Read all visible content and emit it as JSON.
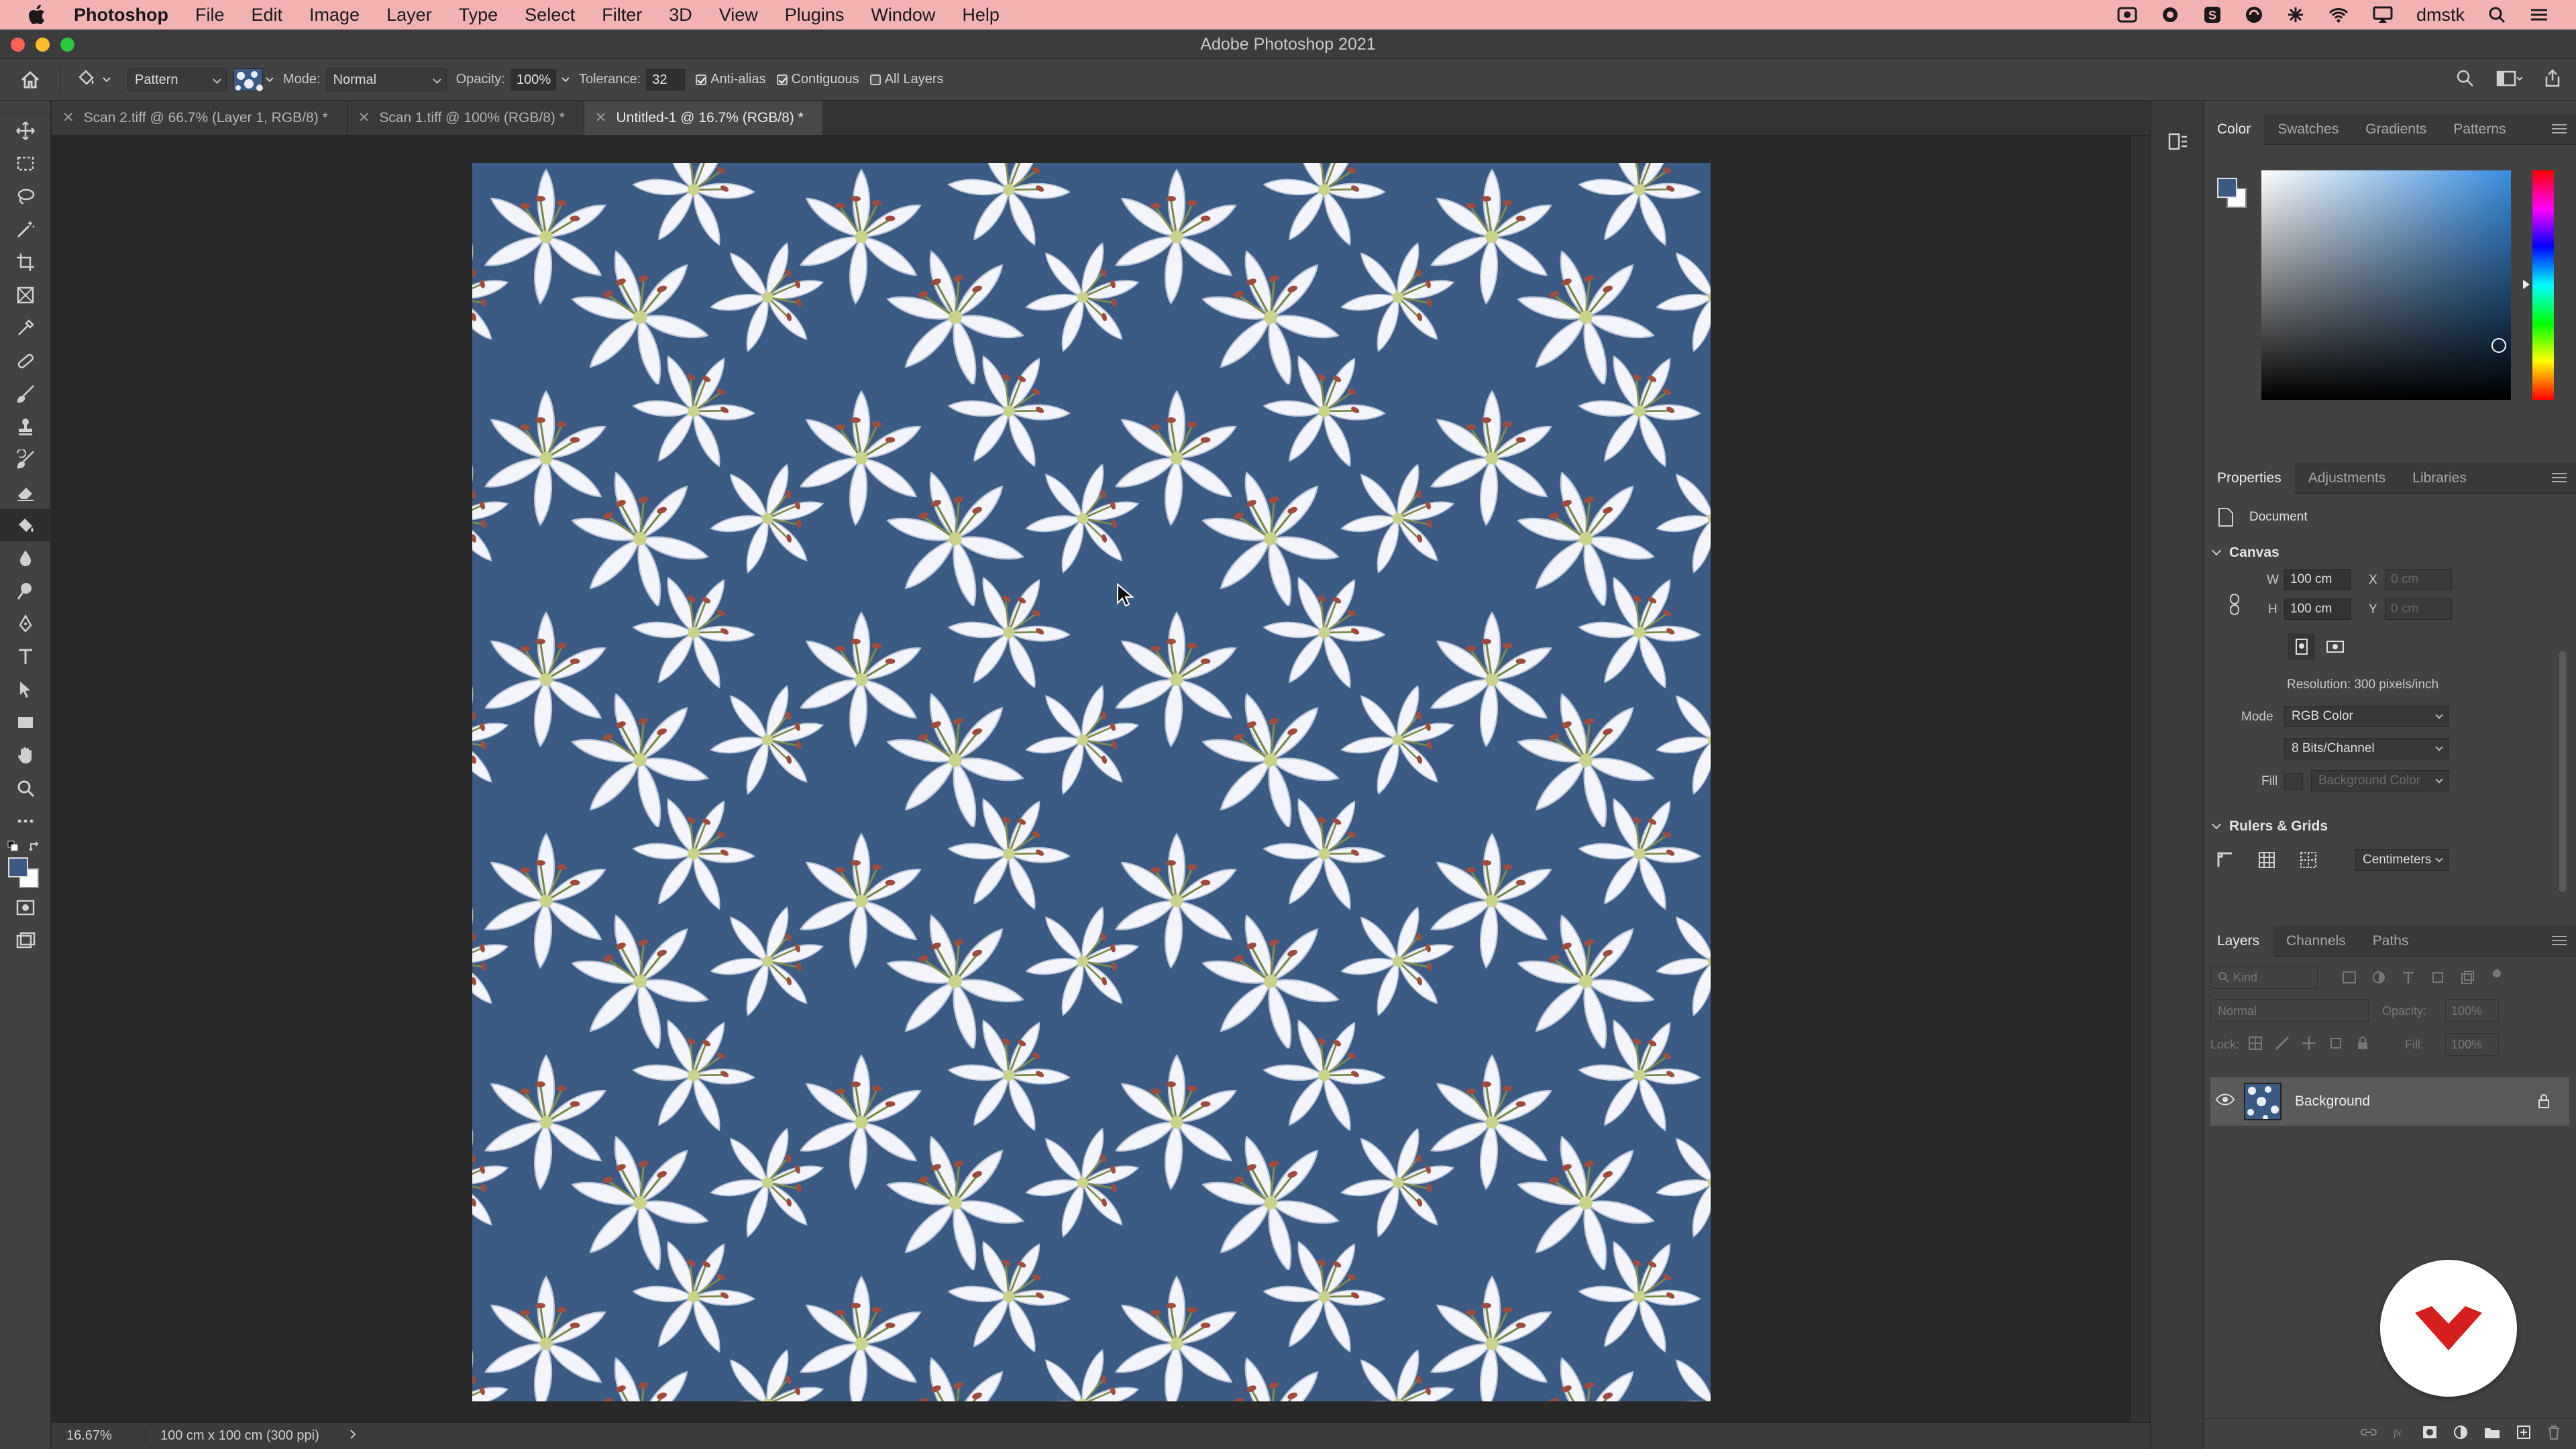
{
  "os_menubar": {
    "app_name": "Photoshop",
    "menus": [
      "File",
      "Edit",
      "Image",
      "Layer",
      "Type",
      "Select",
      "Filter",
      "3D",
      "View",
      "Plugins",
      "Window",
      "Help"
    ],
    "user": "dmstk",
    "status_icons": [
      "creative-cloud-icon",
      "sync-icon",
      "adobe-icon",
      "app-icon",
      "extensions-icon",
      "wifi-icon",
      "airplay-icon",
      "search-icon",
      "control-center-icon"
    ]
  },
  "window": {
    "title": "Adobe Photoshop 2021"
  },
  "options_bar": {
    "fill_source": "Pattern",
    "mode_label": "Mode:",
    "mode_value": "Normal",
    "opacity_label": "Opacity:",
    "opacity_value": "100%",
    "tolerance_label": "Tolerance:",
    "tolerance_value": "32",
    "anti_alias_label": "Anti-alias",
    "anti_alias_checked": true,
    "contiguous_label": "Contiguous",
    "contiguous_checked": true,
    "all_layers_label": "All Layers",
    "all_layers_checked": false
  },
  "tools": [
    "move-tool",
    "marquee-tool",
    "lasso-tool",
    "magic-wand-tool",
    "crop-tool",
    "frame-tool",
    "eyedropper-tool",
    "healing-brush-tool",
    "brush-tool",
    "clone-stamp-tool",
    "history-brush-tool",
    "eraser-tool",
    "paint-bucket-tool",
    "blur-tool",
    "dodge-tool",
    "pen-tool",
    "type-tool",
    "path-selection-tool",
    "rectangle-tool",
    "hand-tool",
    "zoom-tool",
    "more-tools"
  ],
  "active_tool": "paint-bucket-tool",
  "colors": {
    "foreground": "#3b5b85",
    "background": "#ffffff"
  },
  "document_tabs": [
    {
      "label": "Scan 2.tiff @ 66.7% (Layer 1, RGB/8) *",
      "active": false
    },
    {
      "label": "Scan 1.tiff @ 100% (RGB/8) *",
      "active": false
    },
    {
      "label": "Untitled-1 @ 16.7% (RGB/8) *",
      "active": true
    }
  ],
  "status_bar": {
    "zoom": "16.67%",
    "doc_size": "100 cm x 100 cm (300 ppi)"
  },
  "color_panel": {
    "tabs": [
      "Color",
      "Swatches",
      "Gradients",
      "Patterns"
    ],
    "active_tab": "Color",
    "hue_color": "#3a8ee0"
  },
  "properties_panel": {
    "tabs": [
      "Properties",
      "Adjustments",
      "Libraries"
    ],
    "active_tab": "Properties",
    "doc_label": "Document",
    "canvas_heading": "Canvas",
    "w_label": "W",
    "w_value": "100 cm",
    "h_label": "H",
    "h_value": "100 cm",
    "x_label": "X",
    "x_placeholder": "0 cm",
    "y_label": "Y",
    "y_placeholder": "0 cm",
    "resolution": "Resolution: 300 pixels/inch",
    "mode_label": "Mode",
    "mode_value": "RGB Color",
    "bits_value": "8 Bits/Channel",
    "fill_label": "Fill",
    "fill_value": "Background Color",
    "rulers_heading": "Rulers & Grids",
    "units_value": "Centimeters"
  },
  "layers_panel": {
    "tabs": [
      "Layers",
      "Channels",
      "Paths"
    ],
    "active_tab": "Layers",
    "kind_placeholder": "Kind",
    "blend_mode": "Normal",
    "opacity_label": "Opacity:",
    "opacity_value": "100%",
    "lock_label": "Lock:",
    "fill_label": "Fill:",
    "fill_value": "100%",
    "layers": [
      {
        "name": "Background",
        "visible": true,
        "locked": true
      }
    ]
  }
}
